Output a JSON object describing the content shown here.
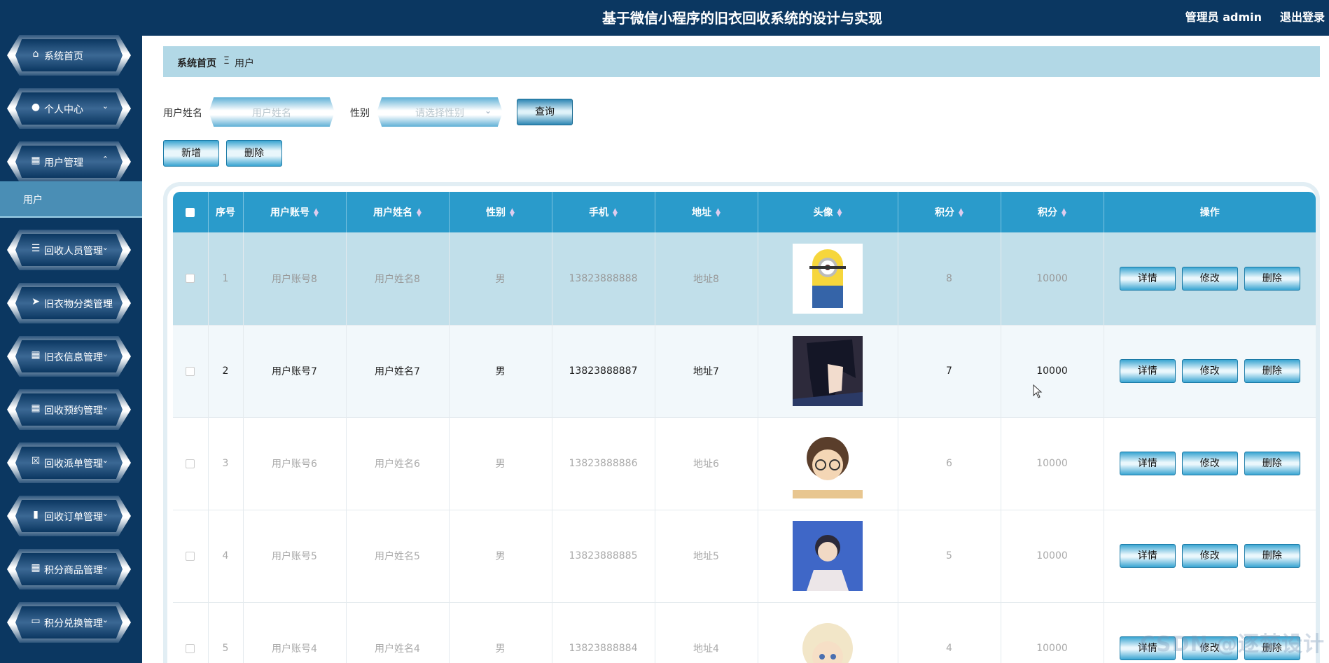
{
  "header": {
    "title": "基于微信小程序的旧衣回收系统的设计与实现",
    "user": "管理员 admin",
    "logout": "退出登录"
  },
  "sidebar": {
    "items": [
      {
        "label": "系统首页",
        "icon": "home-icon",
        "glyph": "⌂",
        "chev": ""
      },
      {
        "label": "个人中心",
        "icon": "user-icon",
        "glyph": "●",
        "chev": "⌄"
      },
      {
        "label": "用户管理",
        "icon": "grid-icon",
        "glyph": "▦",
        "chev": "⌃"
      },
      {
        "label": "回收人员管理",
        "icon": "list-icon",
        "glyph": "☰",
        "chev": "⌄"
      },
      {
        "label": "旧衣物分类管理",
        "icon": "send-icon",
        "glyph": "➤",
        "chev": "⌄"
      },
      {
        "label": "旧衣信息管理",
        "icon": "grid-icon",
        "glyph": "▦",
        "chev": "⌄"
      },
      {
        "label": "回收预约管理",
        "icon": "grid-icon",
        "glyph": "▦",
        "chev": "⌄"
      },
      {
        "label": "回收派单管理",
        "icon": "clipboard-icon",
        "glyph": "☒",
        "chev": "⌄"
      },
      {
        "label": "回收订单管理",
        "icon": "book-icon",
        "glyph": "▮",
        "chev": "⌄"
      },
      {
        "label": "积分商品管理",
        "icon": "grid-icon",
        "glyph": "▦",
        "chev": "⌄"
      },
      {
        "label": "积分兑换管理",
        "icon": "monitor-icon",
        "glyph": "▭",
        "chev": "⌄"
      }
    ],
    "submenu": "用户"
  },
  "breadcrumb": {
    "home": "系统首页",
    "sep": "Ξ",
    "current": "用户"
  },
  "filters": {
    "name_label": "用户姓名",
    "name_placeholder": "用户姓名",
    "gender_label": "性别",
    "gender_placeholder": "请选择性别",
    "query": "查询"
  },
  "actions": {
    "add": "新增",
    "delete": "删除"
  },
  "table": {
    "headers": [
      "序号",
      "用户账号",
      "用户姓名",
      "性别",
      "手机",
      "地址",
      "头像",
      "积分",
      "积分",
      "操作"
    ],
    "rows": [
      {
        "no": "1",
        "account": "用户账号8",
        "name": "用户姓名8",
        "gender": "男",
        "phone": "13823888888",
        "addr": "地址8",
        "points": "8",
        "score": "10000",
        "avatar": "minion"
      },
      {
        "no": "2",
        "account": "用户账号7",
        "name": "用户姓名7",
        "gender": "男",
        "phone": "13823888887",
        "addr": "地址7",
        "points": "7",
        "score": "10000",
        "avatar": "anime-dark-hair"
      },
      {
        "no": "3",
        "account": "用户账号6",
        "name": "用户姓名6",
        "gender": "男",
        "phone": "13823888886",
        "addr": "地址6",
        "points": "6",
        "score": "10000",
        "avatar": "anime-glasses"
      },
      {
        "no": "4",
        "account": "用户账号5",
        "name": "用户姓名5",
        "gender": "男",
        "phone": "13823888885",
        "addr": "地址5",
        "points": "5",
        "score": "10000",
        "avatar": "anime-blue-bg"
      },
      {
        "no": "5",
        "account": "用户账号4",
        "name": "用户姓名4",
        "gender": "男",
        "phone": "13823888884",
        "addr": "地址4",
        "points": "4",
        "score": "10000",
        "avatar": "anime-blond"
      }
    ],
    "ops": {
      "detail": "详情",
      "edit": "修改",
      "remove": "删除"
    }
  },
  "watermark": "CSDN @逐梦设计"
}
